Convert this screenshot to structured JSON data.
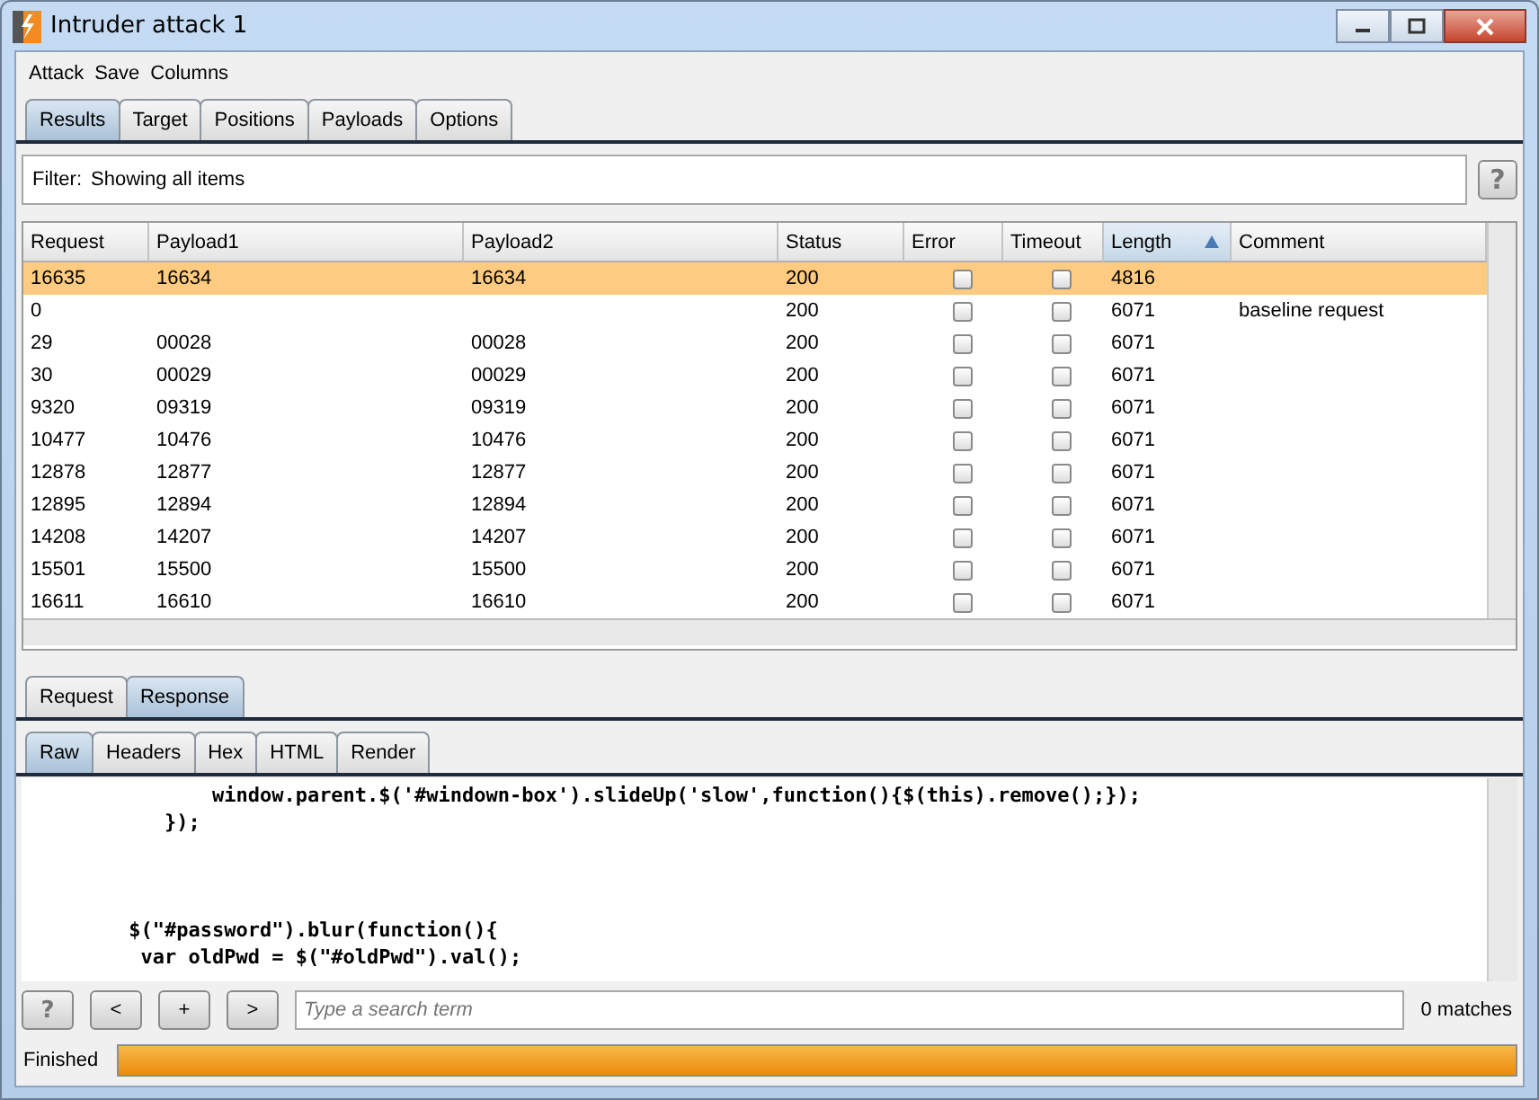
{
  "window": {
    "title": "Intruder attack 1"
  },
  "menu": [
    "Attack",
    "Save",
    "Columns"
  ],
  "tabs": [
    {
      "label": "Results",
      "selected": true
    },
    {
      "label": "Target",
      "selected": false
    },
    {
      "label": "Positions",
      "selected": false
    },
    {
      "label": "Payloads",
      "selected": false
    },
    {
      "label": "Options",
      "selected": false
    }
  ],
  "filter": {
    "label": "Filter:",
    "value": "Showing all items",
    "help": "?"
  },
  "table": {
    "columns": [
      {
        "label": "Request",
        "sorted": false
      },
      {
        "label": "Payload1",
        "sorted": false
      },
      {
        "label": "Payload2",
        "sorted": false
      },
      {
        "label": "Status",
        "sorted": false
      },
      {
        "label": "Error",
        "sorted": false
      },
      {
        "label": "Timeout",
        "sorted": false
      },
      {
        "label": "Length",
        "sorted": true
      },
      {
        "label": "Comment",
        "sorted": false
      }
    ],
    "rows": [
      {
        "selected": true,
        "request": "16635",
        "payload1": "16634",
        "payload2": "16634",
        "status": "200",
        "error": false,
        "timeout": false,
        "length": "4816"
      },
      {
        "selected": false,
        "request": "0",
        "status": "200",
        "error": false,
        "timeout": false,
        "length": "6071",
        "comment": "baseline request"
      },
      {
        "selected": false,
        "request": "29",
        "payload1": "00028",
        "payload2": "00028",
        "status": "200",
        "error": false,
        "timeout": false,
        "length": "6071"
      },
      {
        "selected": false,
        "request": "30",
        "payload1": "00029",
        "payload2": "00029",
        "status": "200",
        "error": false,
        "timeout": false,
        "length": "6071"
      },
      {
        "selected": false,
        "request": "9320",
        "payload1": "09319",
        "payload2": "09319",
        "status": "200",
        "error": false,
        "timeout": false,
        "length": "6071"
      },
      {
        "selected": false,
        "request": "10477",
        "payload1": "10476",
        "payload2": "10476",
        "status": "200",
        "error": false,
        "timeout": false,
        "length": "6071"
      },
      {
        "selected": false,
        "request": "12878",
        "payload1": "12877",
        "payload2": "12877",
        "status": "200",
        "error": false,
        "timeout": false,
        "length": "6071"
      },
      {
        "selected": false,
        "request": "12895",
        "payload1": "12894",
        "payload2": "12894",
        "status": "200",
        "error": false,
        "timeout": false,
        "length": "6071"
      },
      {
        "selected": false,
        "request": "14208",
        "payload1": "14207",
        "payload2": "14207",
        "status": "200",
        "error": false,
        "timeout": false,
        "length": "6071"
      },
      {
        "selected": false,
        "request": "15501",
        "payload1": "15500",
        "payload2": "15500",
        "status": "200",
        "error": false,
        "timeout": false,
        "length": "6071"
      },
      {
        "selected": false,
        "request": "16611",
        "payload1": "16610",
        "payload2": "16610",
        "status": "200",
        "error": false,
        "timeout": false,
        "length": "6071"
      }
    ]
  },
  "message_tabs": [
    {
      "label": "Request",
      "selected": false
    },
    {
      "label": "Response",
      "selected": true
    }
  ],
  "view_tabs": [
    {
      "label": "Raw",
      "selected": true
    },
    {
      "label": "Headers",
      "selected": false
    },
    {
      "label": "Hex",
      "selected": false
    },
    {
      "label": "HTML",
      "selected": false
    },
    {
      "label": "Render",
      "selected": false
    }
  ],
  "code_blocks": [
    [
      "                window.parent.$('#windown-box').slideUp('slow',function(){$(this).remove();});",
      "            });"
    ],
    [
      "         $(\"#password\").blur(function(){",
      "          var oldPwd = $(\"#oldPwd\").val();"
    ]
  ],
  "search": {
    "buttons": [
      "?",
      "<",
      "+",
      ">"
    ],
    "placeholder": "Type a search term",
    "matches": "0 matches"
  },
  "status_bar": {
    "text": "Finished",
    "level": 1
  }
}
